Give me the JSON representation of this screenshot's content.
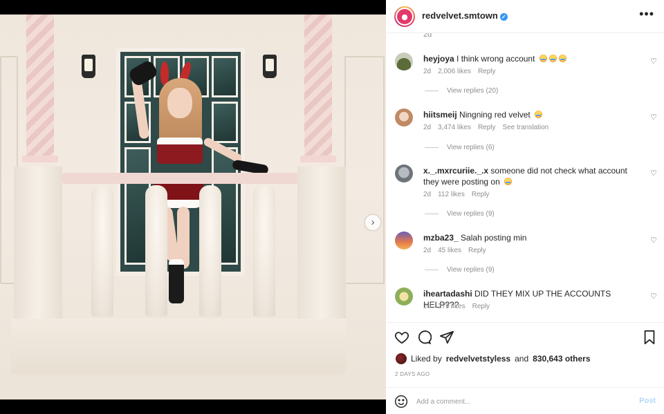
{
  "post": {
    "username": "redvelvet.smtown",
    "verified_icon": "verified-badge-icon",
    "more_icon": "more-options-icon",
    "more_glyph": "•••"
  },
  "media": {
    "next_glyph": "›",
    "carousel": {
      "count": 2,
      "active": 0
    }
  },
  "comments_head": {
    "stray_time": "2d"
  },
  "comments": [
    {
      "user": "heyjoya",
      "text": "I think wrong account",
      "emoji_count": 3,
      "time": "2d",
      "likes": "2,006 likes",
      "reply": "Reply",
      "translate": "",
      "view_replies": "View replies (20)",
      "avatar_color": "#6c7a4a"
    },
    {
      "user": "hiitsmeij",
      "text": "Ningning red velvet",
      "emoji_count": 1,
      "time": "2d",
      "likes": "3,474 likes",
      "reply": "Reply",
      "translate": "See translation",
      "view_replies": "View replies (6)",
      "avatar_color": "#e0b89a"
    },
    {
      "user": "x._.mxrcuriie._.x",
      "text": "someone did not check what account they were posting on",
      "emoji_count": 1,
      "time": "2d",
      "likes": "112 likes",
      "reply": "Reply",
      "translate": "",
      "view_replies": "View replies (9)",
      "avatar_color": "#8a8f96"
    },
    {
      "user": "mzba23_",
      "text": "Salah posting min",
      "emoji_count": 0,
      "time": "2d",
      "likes": "45 likes",
      "reply": "Reply",
      "translate": "",
      "view_replies": "View replies (9)",
      "avatar_color": "#e07a45"
    },
    {
      "user": "iheartadashi",
      "text": "DID THEY MIX UP THE ACCOUNTS HELP???",
      "emoji_count": 0,
      "time": "2d",
      "likes": "279 likes",
      "reply": "Reply",
      "translate": "",
      "view_replies": "",
      "avatar_color": "#9bb36a"
    }
  ],
  "actions": {
    "liked_by_prefix": "Liked by",
    "liked_by_user": "redvelvetstyless",
    "liked_by_and": "and",
    "liked_by_others": "830,643 others",
    "date": "2 DAYS AGO"
  },
  "add_comment": {
    "placeholder": "Add a comment...",
    "post_label": "Post"
  }
}
